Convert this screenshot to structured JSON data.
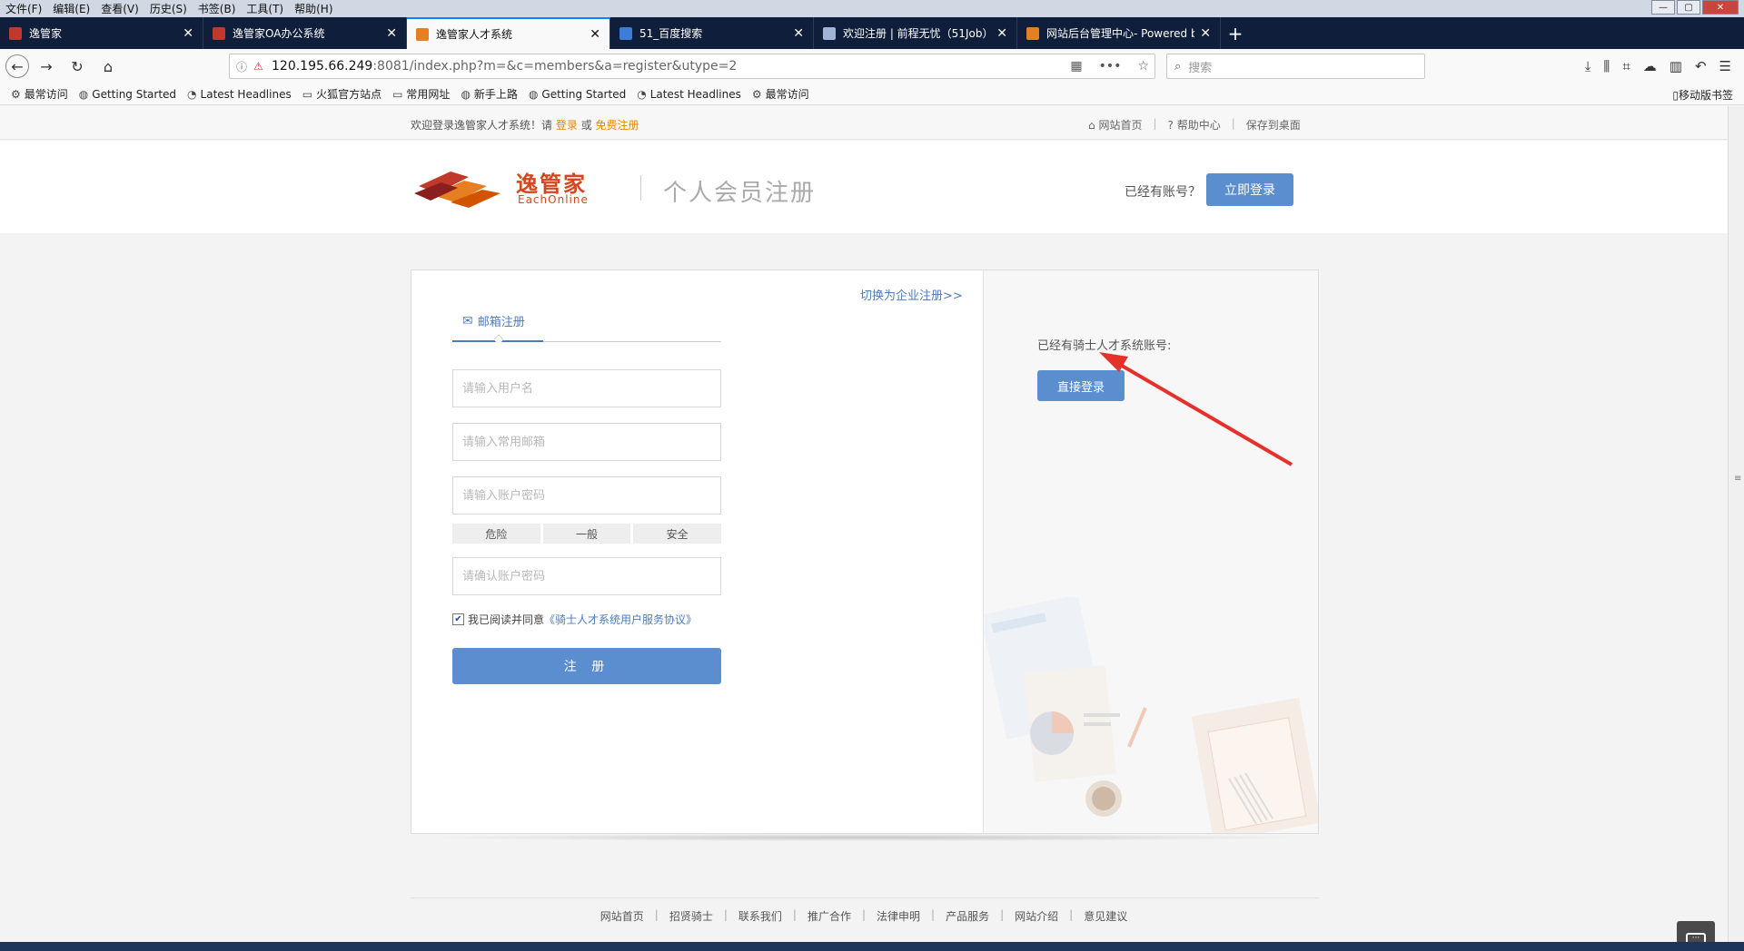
{
  "menubar": {
    "items": [
      "文件(F)",
      "编辑(E)",
      "查看(V)",
      "历史(S)",
      "书签(B)",
      "工具(T)",
      "帮助(H)"
    ]
  },
  "tabs": [
    {
      "title": "逸管家",
      "active": false
    },
    {
      "title": "逸管家OA办公系统",
      "active": false
    },
    {
      "title": "逸管家人才系统",
      "active": true
    },
    {
      "title": "51_百度搜索",
      "active": false
    },
    {
      "title": "欢迎注册 | 前程无忧（51Job）",
      "active": false
    },
    {
      "title": "网站后台管理中心- Powered by",
      "active": false
    }
  ],
  "urlbar": {
    "host": "120.195.66.249",
    "rest": ":8081/index.php?m=&c=members&a=register&utype=2"
  },
  "searchbar": {
    "placeholder": "搜索"
  },
  "bookmarks": {
    "items": [
      "最常访问",
      "Getting Started",
      "Latest Headlines",
      "火狐官方站点",
      "常用网址",
      "新手上路",
      "Getting Started",
      "Latest Headlines",
      "最常访问"
    ],
    "mobile": "移动版书签"
  },
  "topbar": {
    "welcome_prefix": "欢迎登录逸管家人才系统！请",
    "login": "登录",
    "or": "或",
    "register": "免费注册",
    "links": [
      "网站首页",
      "帮助中心",
      "保存到桌面"
    ]
  },
  "header": {
    "logo_cn": "逸管家",
    "logo_en": "EachOnline",
    "page_title": "个人会员注册",
    "have_account": "已经有账号？",
    "login_button": "立即登录"
  },
  "form": {
    "switch_link": "切换为企业注册>>",
    "tab_email": "邮箱注册",
    "username_placeholder": "请输入用户名",
    "email_placeholder": "请输入常用邮箱",
    "password_placeholder": "请输入账户密码",
    "strength": [
      "危险",
      "一般",
      "安全"
    ],
    "confirm_placeholder": "请确认账户密码",
    "agree_text": "我已阅读并同意",
    "agree_link": "《骑士人才系统用户服务协议》",
    "agree_checked": true,
    "submit": "注 册"
  },
  "right_pane": {
    "text": "已经有骑士人才系统账号:",
    "button": "直接登录"
  },
  "footer": {
    "links": [
      "网站首页",
      "招贤骑士",
      "联系我们",
      "推广合作",
      "法律申明",
      "产品服务",
      "网站介绍",
      "意见建议"
    ]
  },
  "colors": {
    "accent": "#5b8ecf",
    "link": "#4a7bbf",
    "orange": "#e08a00",
    "logo": "#d4461e",
    "arrow": "#e5312b"
  }
}
